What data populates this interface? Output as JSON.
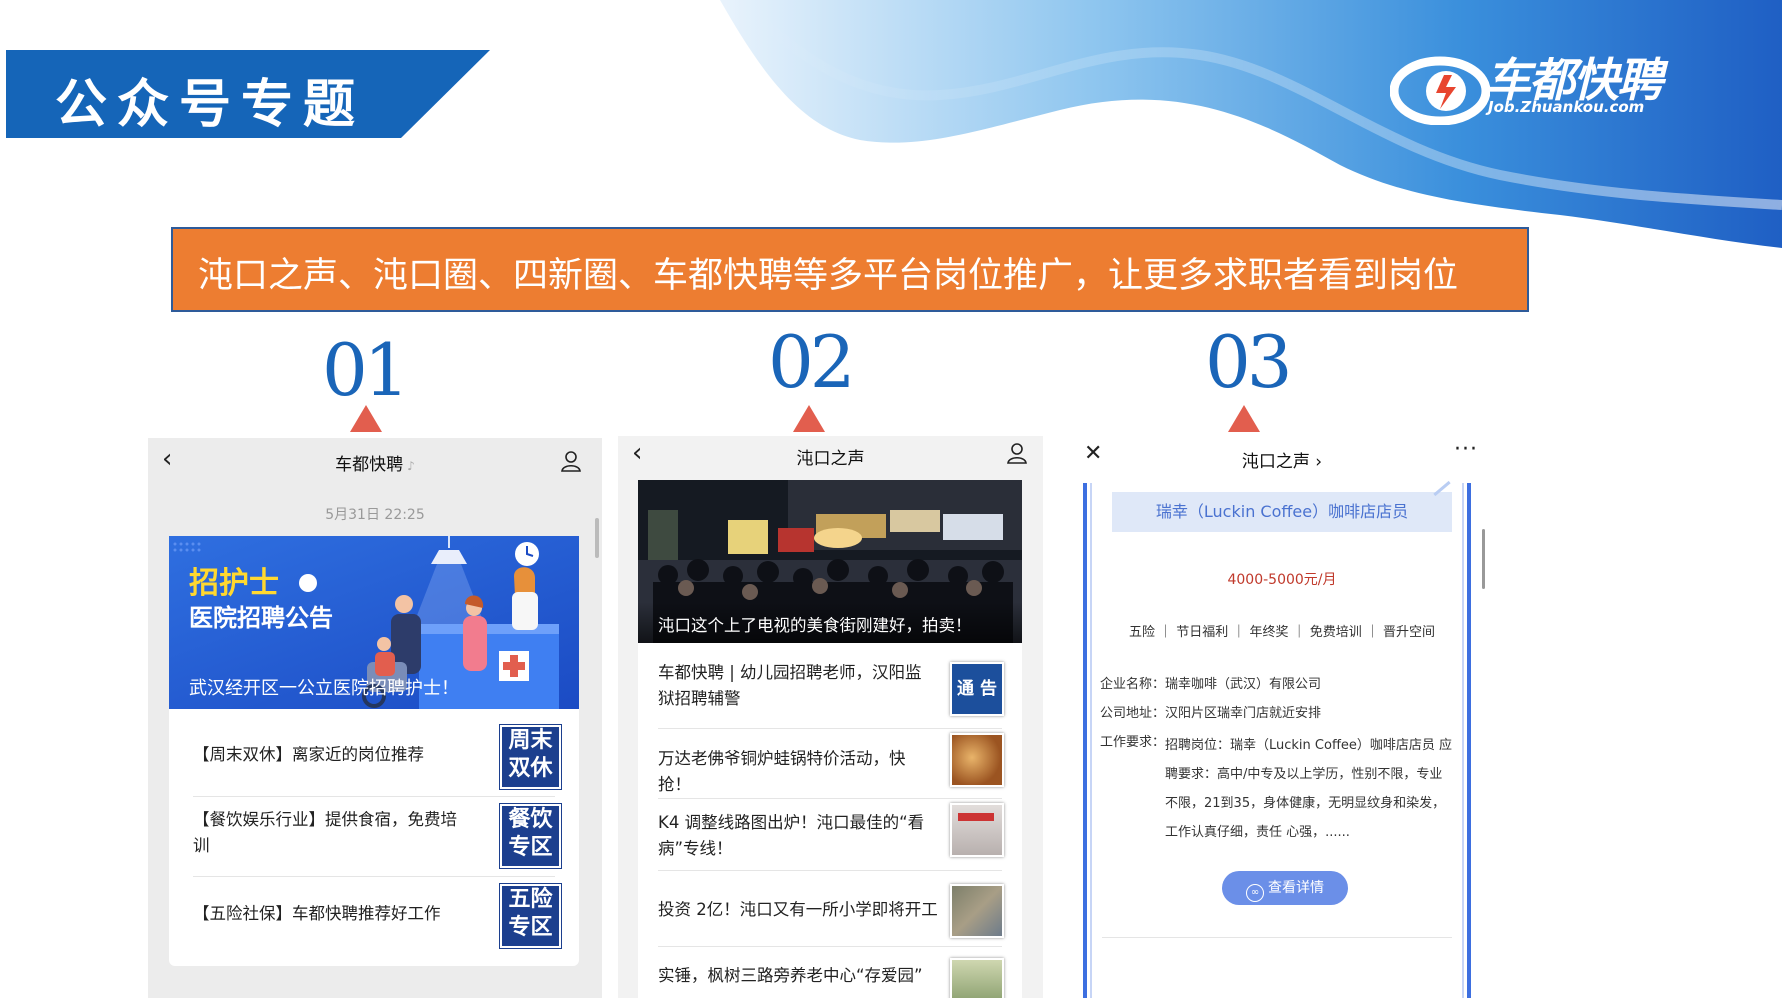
{
  "page": {
    "title": "公众号专题",
    "promo": "沌口之声、沌口圈、四新圈、车都快聘等多平台岗位推广，让更多求职者看到岗位"
  },
  "logo": {
    "name": "车都快聘",
    "url": "Job.Zhuankou.com"
  },
  "steps": [
    "01",
    "02",
    "03"
  ],
  "phone1": {
    "title": "车都快聘",
    "timestamp": "5月31日 22:25",
    "banner": {
      "headline": "招护士",
      "subhead": "医院招聘公告",
      "caption": "武汉经开区一公立医院招聘护士！"
    },
    "items": [
      {
        "text": "【周末双休】离家近的岗位推荐",
        "tag_l1": "周末",
        "tag_l2": "双休"
      },
      {
        "text": "【餐饮娱乐行业】提供食宿，免费培训",
        "tag_l1": "餐饮",
        "tag_l2": "专区"
      },
      {
        "text": "【五险社保】车都快聘推荐好工作",
        "tag_l1": "五险",
        "tag_l2": "专区"
      }
    ]
  },
  "phone2": {
    "title": "沌口之声",
    "hero_caption": "沌口这个上了电视的美食街刚建好，拍卖！",
    "items": [
      {
        "text": "车都快聘 | 幼儿园招聘老师，汉阳监狱招聘辅警",
        "thumb_label": "通 告",
        "thumb_color": "#1c4f9c"
      },
      {
        "text": "万达老佛爷铜炉蛙锅特价活动，快抢！",
        "thumb_color": "#b9733a"
      },
      {
        "text": "K4 调整线路图出炉！沌口最佳的“看病”专线！",
        "thumb_color": "#c9c4c2"
      },
      {
        "text": "投资 2亿！沌口又有一所小学即将开工",
        "thumb_color": "#8f8f7e"
      },
      {
        "text": "实锤，枫树三路旁养老中心“存爱园”",
        "thumb_color": "#9aa57e"
      }
    ]
  },
  "phone3": {
    "title": "沌口之声 ›",
    "job_title": "瑞幸（Luckin Coffee）咖啡店店员",
    "salary": "4000-5000元/月",
    "benefits": "五险 ｜ 节日福利 ｜ 年终奖 ｜ 免费培训 ｜ 晋升空间",
    "company_label": "企业名称：",
    "company": "瑞幸咖啡（武汉）有限公司",
    "address_label": "公司地址：",
    "address": "汉阳片区瑞幸门店就近安排",
    "req_label": "工作要求：",
    "req_l1": "招聘岗位：瑞幸（Luckin Coffee）咖啡店店员 应",
    "req_l2": "聘要求：高中/中专及以上学历，性别不限，专业",
    "req_l3": "不限，21到35，身体健康，无明显纹身和染发，",
    "req_l4": "工作认真仔细，责任 心强，......",
    "button": "查看详情"
  },
  "colors": {
    "brand_blue": "#1565b8",
    "promo_orange": "#ed7d31",
    "tag_navy": "#1c3f8e",
    "salary_red": "#c0392b",
    "accent_red": "#e25e4e"
  },
  "icons": [
    "back-icon",
    "profile-icon",
    "mute-icon",
    "close-icon",
    "more-icon",
    "link-icon",
    "plus-icon"
  ]
}
